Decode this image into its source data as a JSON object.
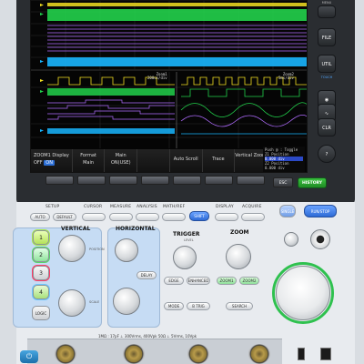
{
  "screen": {
    "zoom_label_1": "Zoom1",
    "zoom_label_2": "Zoom2",
    "zoom_value_1": "200us/div",
    "zoom_value_2": "5ms/div",
    "info_lines": [
      "Push @ : Toggle",
      "Z1 Position",
      "0.000 div",
      "Z2 Position",
      "0.000 div"
    ],
    "info_highlight_index": 2
  },
  "softmenu": [
    {
      "label": "ZOOM1 Display",
      "sub_off": "OFF",
      "sub_on": "ON"
    },
    {
      "label": "Format",
      "sub": "Main"
    },
    {
      "label": "Main",
      "sub": "ON(USE)"
    },
    {
      "label": "",
      "sub": ""
    },
    {
      "label": "Auto Scroll",
      "sub": ""
    },
    {
      "label": "Trace",
      "sub": ""
    },
    {
      "label": "Vertical Zoom",
      "sub": ""
    }
  ],
  "buttons": {
    "esc": "ESC",
    "history": "HISTORY",
    "menu": "MENU",
    "file": "FILE",
    "utility": "UTIL",
    "touch": "TOUCH",
    "clear": "CLR",
    "help": "?"
  },
  "panel": {
    "setup": "SETUP",
    "auto": "AUTO",
    "default": "DEFAULT",
    "cursor": "CURSOR",
    "measure": "MEASURE",
    "analysis": "ANALYSIS",
    "math_ref": "MATH/REF",
    "shift": "SHIFT",
    "display": "DISPLAY",
    "acquire": "ACQUIRE",
    "single": "SINGLE",
    "run_stop": "RUN/STOP",
    "vertical": "VERTICAL",
    "horizontal": "HORIZONTAL",
    "trigger": "TRIGGER",
    "zoom": "ZOOM",
    "delay": "DELAY",
    "edge": "EDGE",
    "enhanced": "ENHANCED",
    "mode": "MODE",
    "btrig": "B TRIG",
    "zoom1": "ZOOM1",
    "zoom2": "ZOOM2",
    "search": "SEARCH",
    "logic": "LOGIC",
    "level": "LEVEL",
    "position": "POSITION",
    "scale": "SCALE",
    "channels": [
      "1",
      "2",
      "3",
      "4"
    ],
    "spec": "1MΩ : 17pF ⊥ 300Vrms, 400Vpk   50Ω ⊥ 5Vrms, 10Vpk"
  },
  "colors": {
    "ch1": "#f4e022",
    "ch2": "#22d14b",
    "ch3": "#ff2b54",
    "ch4": "#19b6ff",
    "logic": "#b06cff",
    "history": "#2fb33a",
    "run_stop": "#2e6bd6"
  }
}
